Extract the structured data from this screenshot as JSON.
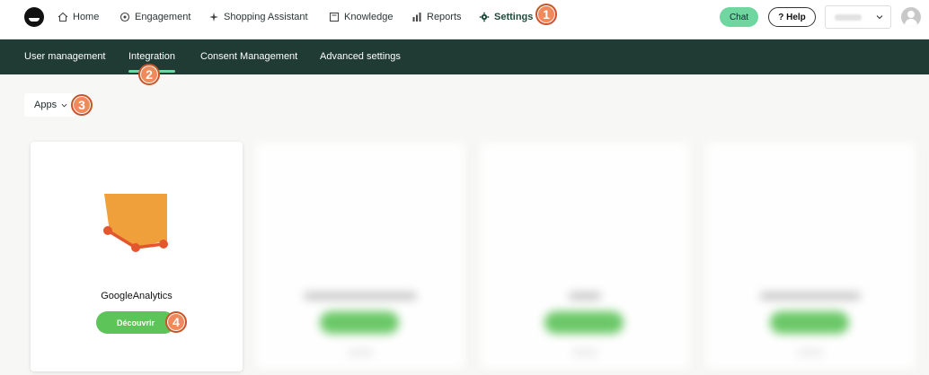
{
  "topnav": {
    "items": [
      {
        "label": "Home",
        "icon": "home-icon"
      },
      {
        "label": "Engagement",
        "icon": "engagement-icon"
      },
      {
        "label": "Shopping Assistant",
        "icon": "sparkle-icon"
      },
      {
        "label": "Knowledge",
        "icon": "book-icon"
      },
      {
        "label": "Reports",
        "icon": "bar-chart-icon"
      },
      {
        "label": "Settings",
        "icon": "gear-icon"
      }
    ],
    "chat_label": "Chat",
    "help_label": "? Help"
  },
  "subnav": {
    "items": [
      {
        "label": "User management"
      },
      {
        "label": "Integration"
      },
      {
        "label": "Consent Management"
      },
      {
        "label": "Advanced settings"
      }
    ]
  },
  "filter": {
    "label": "Apps"
  },
  "cards": [
    {
      "title": "GoogleAnalytics",
      "button": "Découvrir"
    }
  ],
  "annotations": [
    "1",
    "2",
    "3",
    "4"
  ],
  "colors": {
    "accent_green": "#6fd6a0",
    "button_green": "#5dc45a",
    "subnav_bg": "#1f3b33",
    "badge": "#f08a5d",
    "ga_orange": "#f0a03a",
    "ga_line": "#e4572e"
  }
}
